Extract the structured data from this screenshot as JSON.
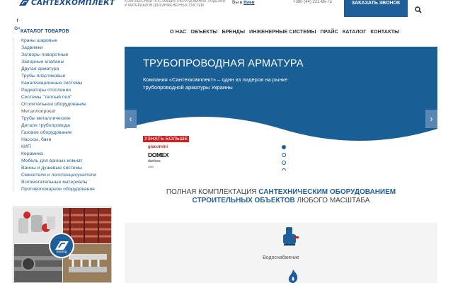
{
  "header": {
    "logo_text": "САНТЕХКОМПЛЕКТ",
    "tagline": "КОМПЛЕКСНЫЙ ПОСТАВЩИК ОБОРУДОВАНИЯ, ИЗДЕЛИЙ И МАТЕРИАЛОВ ДЛЯ ИНЖЕНЕРНЫХ СИСТЕМ",
    "city_prefix": "Вы в",
    "city": "Киев",
    "phone": "+380 (44) 221-86-75",
    "callback_label": "ЗАКАЗАТЬ ЗВОНОК",
    "brand_color": "#1f5f99"
  },
  "social": {
    "facebook": "f",
    "google": "G+"
  },
  "nav": {
    "items": [
      "О НАС",
      "ОБЪЕКТЫ",
      "БРЕНДЫ",
      "ИНЖЕНЕРНЫЕ СИСТЕМЫ",
      "ПРАЙС",
      "КАТАЛОГ",
      "КОНТАКТЫ"
    ]
  },
  "sidebar": {
    "title": "КАТАЛОГ ТОВАРОВ",
    "items": [
      "Краны шаровые",
      "Задвижки",
      "Затворы поворотные",
      "Запорные клапаны",
      "Другая арматура",
      "Трубы пластиковые",
      "Канализационные системы",
      "Радиаторы отопления",
      "Системы \"теплый пол\"",
      "Отопительное оборудование",
      "Металлопрокат",
      "Трубы металлические",
      "Детали трубопровода",
      "Газовое оборудование",
      "Насосы, баки",
      "КИП",
      "Керамика",
      "Мебель для ванных комнат",
      "Ванны и душевые системы",
      "Смесители и полотенцесушители",
      "Вспомогательные материалы",
      "Противопожарное оборудование"
    ],
    "promo_badge": "training"
  },
  "hero": {
    "title": "ТРУБОПРОВОДНАЯ АРМАТУРА",
    "subtitle": "Компания «Сантехкомплект» – один из лидеров на рынке трубопроводной арматуры Украины",
    "cta": "УЗНАТЬ БОЛЬШЕ",
    "brands": [
      "giacomini",
      "DOMEX",
      "danfoss",
      "ABB"
    ],
    "slide_count": 4,
    "active_slide": 0
  },
  "section": {
    "line1_pre": "ПОЛНАЯ КОМПЛЕКТАЦИЯ ",
    "line1_hl": "САНТЕХНИЧЕСКИМ ОБОРУДОВАНИЕМ",
    "line2_hl": "СТРОИТЕЛЬНЫХ ОБЪЕКТОВ",
    "line2_post": " ЛЮБОГО МАСШТАБА",
    "card_label": "Водоснабжение"
  }
}
